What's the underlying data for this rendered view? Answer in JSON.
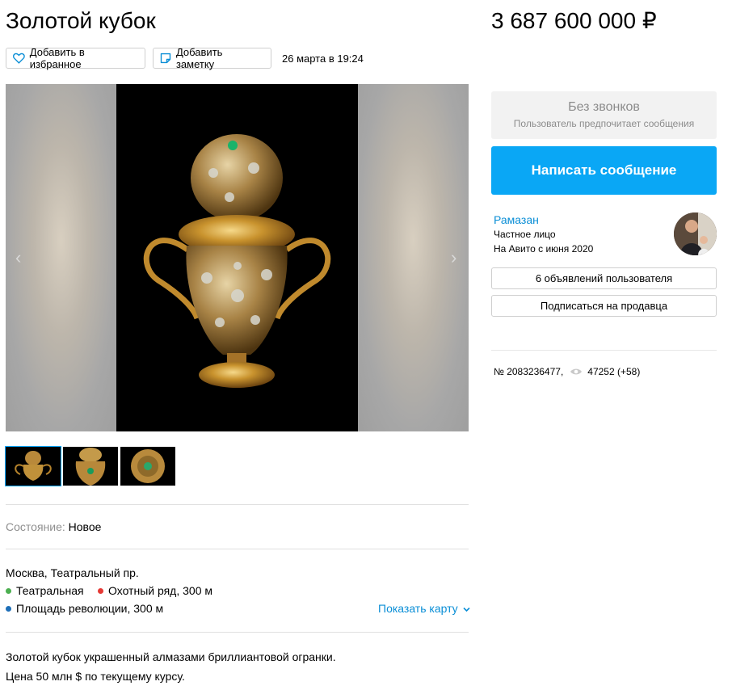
{
  "listing": {
    "title": "Золотой кубок",
    "price": "3 687 600 000 ₽",
    "date": "26 марта в 19:24"
  },
  "actions": {
    "favorite_label": "Добавить в избранное",
    "note_label": "Добавить заметку"
  },
  "params": {
    "condition_label": "Состояние:",
    "condition_value": "Новое"
  },
  "location": {
    "address": "Москва, Театральный пр.",
    "metro": [
      {
        "name": "Театральная",
        "color": "#4caf50"
      },
      {
        "name": "Охотный ряд, 300 м",
        "color": "#e53935"
      },
      {
        "name": "Площадь революции, 300 м",
        "color": "#1e6fb8"
      }
    ],
    "show_map_label": "Показать карту"
  },
  "description": {
    "line1": "Золотой кубок украшенный алмазами бриллиантовой огранки.",
    "line2": "Цена 50 млн $ по текущему курсу."
  },
  "contact": {
    "no_calls_title": "Без звонков",
    "no_calls_sub": "Пользователь предпочитает сообщения",
    "message_button": "Написать сообщение"
  },
  "seller": {
    "name": "Рамазан",
    "type": "Частное лицо",
    "since": "На Авито с июня 2020",
    "ads_button": "6 объявлений пользователя",
    "subscribe_button": "Подписаться на продавца"
  },
  "meta": {
    "number": "№ 2083236477,",
    "views": "47252 (+58)"
  },
  "colors": {
    "accent": "#0aa7f5",
    "link": "#0a8ed6"
  },
  "icons": [
    "heart-icon",
    "note-icon",
    "eye-icon",
    "chevron-left-icon",
    "chevron-right-icon",
    "chevron-down-icon"
  ]
}
